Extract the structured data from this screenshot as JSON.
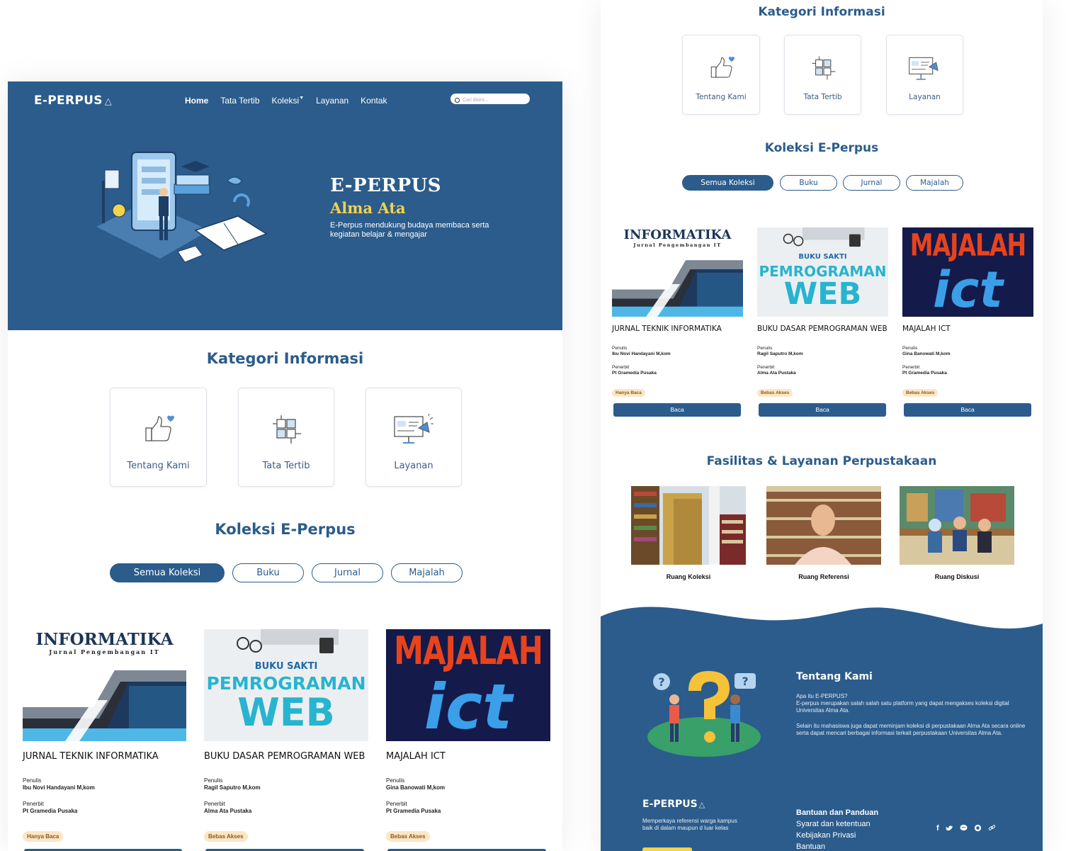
{
  "brand": {
    "name": "E-PERPUS",
    "logo_icon": "library-triangle-icon"
  },
  "nav": {
    "home": "Home",
    "rules": "Tata Tertib",
    "collection": "Koleksi",
    "services": "Layanan",
    "contact": "Kontak",
    "search_placeholder": "Cari disini..."
  },
  "hero": {
    "title": "E-PERPUS",
    "subtitle": "Alma Ata",
    "description": "E-Perpus mendukung budaya membaca serta kegiatan belajar & mengajar"
  },
  "categories": {
    "title": "Kategori Informasi",
    "items": [
      {
        "label": "Tentang Kami",
        "icon": "thumbs-up-icon"
      },
      {
        "label": "Tata Tertib",
        "icon": "puzzle-hands-icon"
      },
      {
        "label": "Layanan",
        "icon": "presentation-icon"
      }
    ]
  },
  "collection": {
    "title": "Koleksi E-Perpus",
    "filters": [
      "Semua Koleksi",
      "Buku",
      "Jurnal",
      "Majalah"
    ],
    "active_filter": "Semua Koleksi",
    "author_label": "Penulis",
    "publisher_label": "Penerbit",
    "read_label": "Baca",
    "books": [
      {
        "title": "JURNAL TEKNIK INFORMATIKA",
        "author": "Ibu Novi Handayani M,kom",
        "publisher": "Pt Gramedia Pusaka",
        "badge": "Hanya Baca",
        "cover_line1": "INFORMATIKA",
        "cover_line2": "Jurnal Pengembangan IT"
      },
      {
        "title": "BUKU DASAR PEMROGRAMAN WEB",
        "author": "Ragil Saputro M,kom",
        "publisher": "Alma Ata Pustaka",
        "badge": "Bebas Akses",
        "cover_line1": "BUKU SAKTI",
        "cover_line2": "PEMROGRAMAN",
        "cover_line3": "WEB"
      },
      {
        "title": "MAJALAH ICT",
        "author": "Gina Banowati M,kom",
        "publisher": "Pt Gramedia Pusaka",
        "badge": "Bebas Akses",
        "cover_line1": "MAJALAH",
        "cover_line2": "ict"
      }
    ]
  },
  "facilities": {
    "title": "Fasilitas & Layanan Perpustakaan",
    "items": [
      {
        "label": "Ruang Koleksi"
      },
      {
        "label": "Ruang Referensi"
      },
      {
        "label": "Ruang Diskusi"
      }
    ]
  },
  "footer": {
    "about_title": "Tentang Kami",
    "about_q": "Apa itu E-PERPUS?",
    "about_p1": "E-perpus merupakan salah salah satu platform yang dapat mengakses koleksi digital Universitas Alma Ata.",
    "about_p2": "Selain itu mahasiswa juga dapat meminjam koleksi di perpustakaan Alma Ata secara online serta dapat mencari berbagai informasi terkait perpustakaan Universitas Alma Ata.",
    "tagline": "Memperkaya referensi warga kampus baik di dalam maupun d luar kelas",
    "help_title": "Bantuan dan Panduan",
    "help_links": [
      "Syarat dan ketentuan",
      "Kebijakan Privasi",
      "Bantuan"
    ],
    "socials": [
      "facebook-icon",
      "twitter-icon",
      "chat-icon",
      "whatsapp-icon",
      "link-icon"
    ]
  },
  "colors": {
    "primary": "#2b5c8c",
    "accent": "#f5d24a",
    "badge_bg": "#fbe6c6"
  }
}
